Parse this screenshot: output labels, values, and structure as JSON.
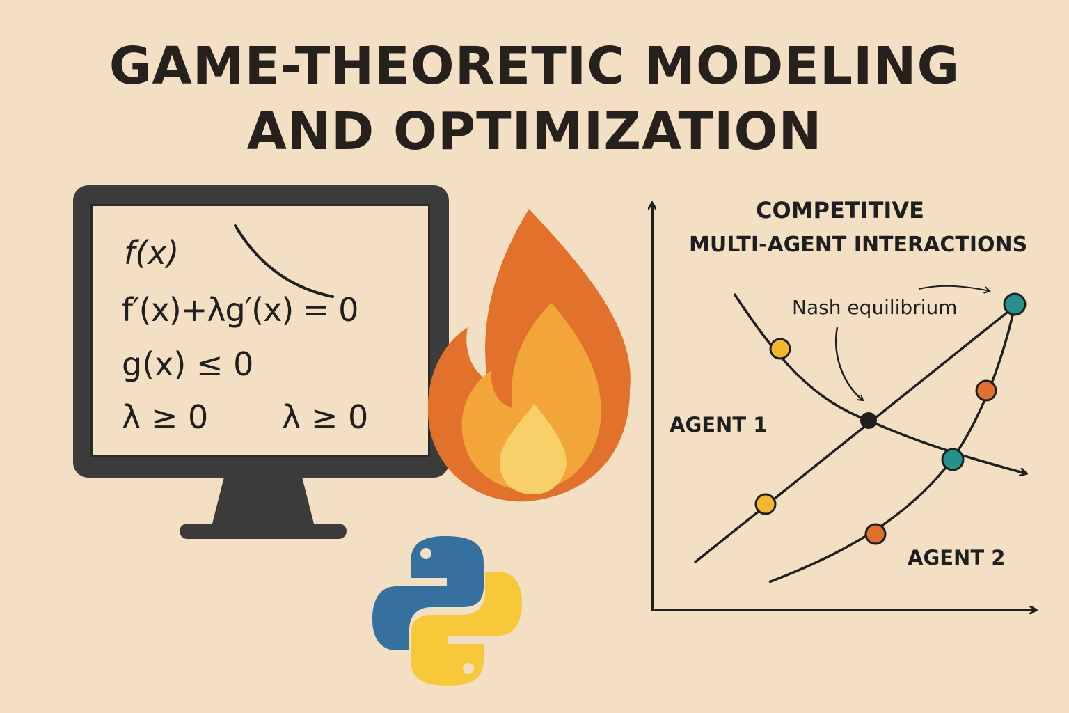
{
  "title": {
    "line1": "GAME-THEORETIC MODELING",
    "line2": "AND OPTIMIZATION"
  },
  "monitor": {
    "equations": {
      "fx": "f(x)",
      "lagrange": "f′(x)+λg′(x) = 0",
      "constraint": "g(x) ≤ 0",
      "lambda1": "λ ≥ 0",
      "lambda2": "λ ≥ 0"
    }
  },
  "icons": {
    "monitor": "monitor-icon",
    "flame": "flame-icon",
    "python": "python-logo"
  },
  "diagram": {
    "heading_line1": "COMPETITIVE",
    "heading_line2": "MULTI-AGENT INTERACTIONS",
    "nash_label": "Nash equilibrium",
    "agent1_label": "AGENT 1",
    "agent2_label": "AGENT 2"
  },
  "colors": {
    "background": "#f3dfc3",
    "ink": "#1f1f1f",
    "monitor": "#3b3b3c",
    "flame_outer": "#e2712b",
    "flame_mid": "#f2a63a",
    "flame_inner": "#f8d06a",
    "python_blue": "#36709f",
    "python_yellow": "#f6c83a",
    "point_yellow": "#f3b631",
    "point_orange": "#e0702b",
    "point_teal": "#25908c"
  }
}
